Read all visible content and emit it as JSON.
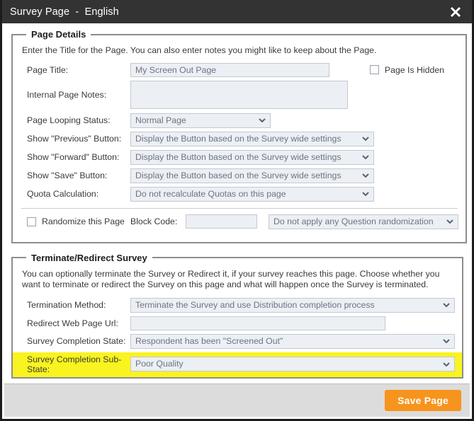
{
  "titlebar": {
    "title": "Survey Page  -  English",
    "close_icon": "close-icon"
  },
  "page_details": {
    "legend": "Page Details",
    "description": "Enter the Title for the Page. You can also enter notes you might like to keep about the Page.",
    "page_title": {
      "label": "Page Title:",
      "value": "My Screen Out Page"
    },
    "page_is_hidden": {
      "label": "Page Is Hidden",
      "checked": false
    },
    "internal_page_notes": {
      "label": "Internal Page Notes:",
      "value": ""
    },
    "page_looping_status": {
      "label": "Page Looping Status:",
      "value": "Normal Page"
    },
    "show_previous_button": {
      "label": "Show \"Previous\" Button:",
      "value": "Display the Button based on the Survey wide settings"
    },
    "show_forward_button": {
      "label": "Show \"Forward\" Button:",
      "value": "Display the Button based on the Survey wide settings"
    },
    "show_save_button": {
      "label": "Show \"Save\" Button:",
      "value": "Display the Button based on the Survey wide settings"
    },
    "quota_calculation": {
      "label": "Quota Calculation:",
      "value": "Do not recalculate Quotas on this page"
    },
    "randomize_this_page": {
      "label": "Randomize this Page",
      "checked": false
    },
    "block_code": {
      "label": "Block Code:",
      "value": ""
    },
    "question_randomization": {
      "value": "Do not apply any Question randomization"
    }
  },
  "terminate_redirect": {
    "legend": "Terminate/Redirect Survey",
    "description": "You can optionally terminate the Survey or Redirect it, if your survey reaches this page. Choose whether you want to terminate or redirect the Survey on this page and what will happen once the Survey is terminated.",
    "termination_method": {
      "label": "Termination Method:",
      "value": "Terminate the Survey and use Distribution completion process"
    },
    "redirect_web_page_url": {
      "label": "Redirect Web Page Url:",
      "value": ""
    },
    "survey_completion_state": {
      "label": "Survey Completion State:",
      "value": "Respondent has been \"Screened Out\""
    },
    "survey_completion_sub_state": {
      "label": "Survey Completion Sub-State:",
      "value": "Poor Quality",
      "highlight_color": "#f9f31f"
    }
  },
  "footer": {
    "save_label": "Save Page",
    "save_color": "#f7941e"
  }
}
